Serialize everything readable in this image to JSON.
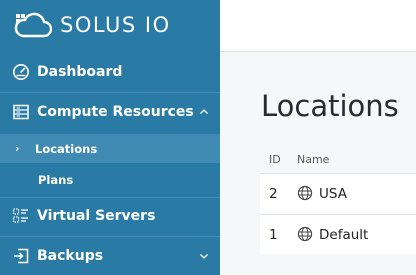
{
  "brand": {
    "name": "SOLUS IO"
  },
  "sidebar": {
    "items": [
      {
        "label": "Dashboard",
        "icon": "speedometer-icon"
      },
      {
        "label": "Compute Resources",
        "icon": "server-list-icon",
        "expanded": true,
        "children": [
          {
            "label": "Locations",
            "active": true,
            "marker": "›"
          },
          {
            "label": "Plans",
            "active": false
          }
        ]
      },
      {
        "label": "Virtual Servers",
        "icon": "virtual-servers-icon"
      },
      {
        "label": "Backups",
        "icon": "backup-icon",
        "expanded": false
      }
    ]
  },
  "main": {
    "title": "Locations",
    "table": {
      "columns": [
        "ID",
        "Name"
      ],
      "rows": [
        {
          "id": "2",
          "name": "USA",
          "icon": "globe-icon"
        },
        {
          "id": "1",
          "name": "Default",
          "icon": "globe-icon"
        }
      ]
    }
  },
  "colors": {
    "sidebar_bg": "#2a7aa6",
    "sidebar_active_bg": "#3f8bb4",
    "content_bg": "#f6f7f8",
    "text_dark": "#2b2b2b"
  }
}
